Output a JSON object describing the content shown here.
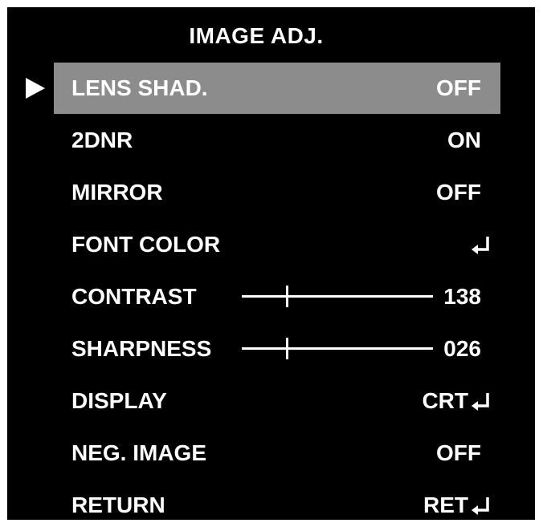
{
  "menu": {
    "title": "IMAGE ADJ.",
    "items": [
      {
        "label": "LENS SHAD.",
        "value": "OFF"
      },
      {
        "label": "2DNR",
        "value": "ON"
      },
      {
        "label": "MIRROR",
        "value": "OFF"
      },
      {
        "label": "FONT COLOR",
        "value": ""
      },
      {
        "label": "CONTRAST",
        "value": "138"
      },
      {
        "label": "SHARPNESS",
        "value": "026"
      },
      {
        "label": "DISPLAY",
        "value": "CRT"
      },
      {
        "label": "NEG. IMAGE",
        "value": "OFF"
      },
      {
        "label": "RETURN",
        "value": "RET"
      }
    ]
  },
  "icons": {
    "cursor": "selection-arrow-icon",
    "enter": "enter-return-icon"
  },
  "colors": {
    "background": "#000000",
    "text": "#ffffff",
    "highlight": "#8c8c8c"
  }
}
